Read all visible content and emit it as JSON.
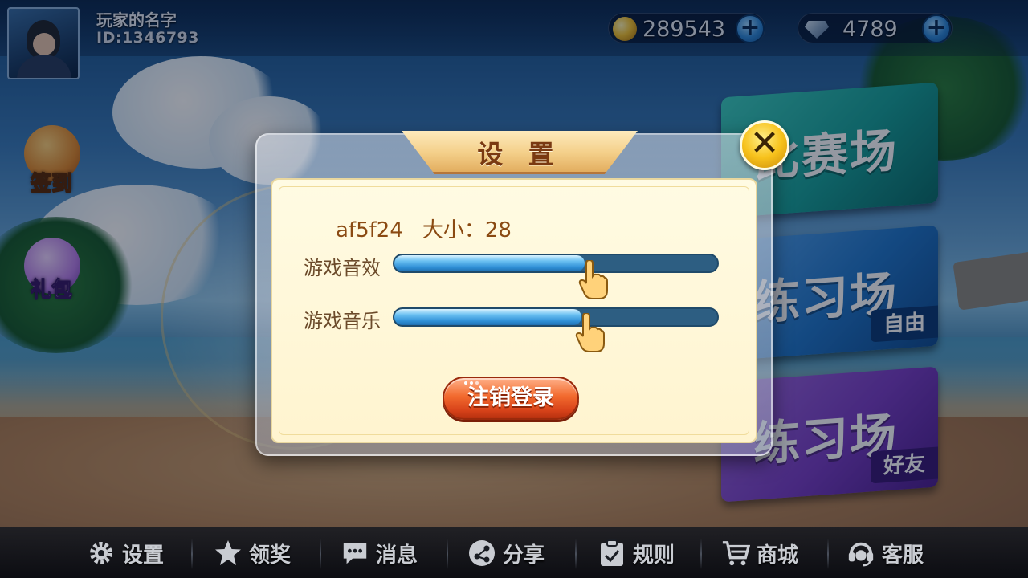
{
  "player": {
    "name": "玩家的名字",
    "id_label": "ID:1346793"
  },
  "currency": {
    "coins": "289543",
    "gems": "4789",
    "coin_icon": "coin-icon",
    "gem_icon": "diamond-icon"
  },
  "side_buttons": {
    "signin_label": "签到",
    "gift_label": "礼包"
  },
  "modes": {
    "match": {
      "label": "比赛场"
    },
    "practice_free": {
      "label": "练习场",
      "tag": "自由"
    },
    "practice_friend": {
      "label": "练习场",
      "tag": "好友"
    }
  },
  "bottom_nav": {
    "items": [
      {
        "label": "设置",
        "icon": "gear-icon"
      },
      {
        "label": "领奖",
        "icon": "star-icon"
      },
      {
        "label": "消息",
        "icon": "chat-icon"
      },
      {
        "label": "分享",
        "icon": "share-icon"
      },
      {
        "label": "规则",
        "icon": "rules-icon"
      },
      {
        "label": "商城",
        "icon": "cart-icon"
      },
      {
        "label": "客服",
        "icon": "headset-icon"
      }
    ]
  },
  "settings_modal": {
    "title": "设 置",
    "version": "af5f24",
    "size_text": "大小：28",
    "sliders": [
      {
        "label": "游戏音效",
        "level": 0.59
      },
      {
        "label": "游戏音乐",
        "level": 0.58
      }
    ],
    "logout_label": "注销登录"
  },
  "colors": {
    "modal_bg": "#fff6d6",
    "title_text": "#7a3a12",
    "slider_fill": "#3aa2e6",
    "slider_track": "#2d5e82",
    "logout_button": "#e8511f",
    "match_banner": "#1aa39a",
    "practice_free_banner": "#2277c9",
    "practice_friend_banner": "#7b3fc4"
  }
}
